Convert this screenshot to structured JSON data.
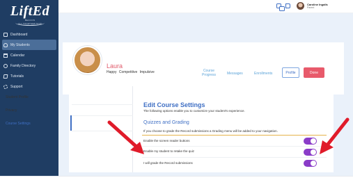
{
  "app": {
    "logo_text": "LiftEd",
    "logo_subtitle": "BEACON",
    "logo_tagline": "ALL TOGETHER NOW"
  },
  "sidebar": {
    "items": [
      {
        "label": "Dashboard",
        "icon": "dashboard-icon",
        "active": false
      },
      {
        "label": "My Students",
        "icon": "students-icon",
        "active": true
      },
      {
        "label": "Calendar",
        "icon": "calendar-icon",
        "active": false
      },
      {
        "label": "Family Directory",
        "icon": "family-icon",
        "active": false
      },
      {
        "label": "Tutorials",
        "icon": "tutorials-icon",
        "active": false
      },
      {
        "label": "Support",
        "icon": "support-icon",
        "active": false
      }
    ]
  },
  "topbar": {
    "user_name": "Caroline Ingalls",
    "user_role": "Parent",
    "icons": [
      "chat-icon",
      "book-icon"
    ]
  },
  "student": {
    "name": "Laura",
    "traits": "Happy  Competitive  Impulsive"
  },
  "tabs": {
    "course_progress": "Course Progress",
    "messages": "Messages",
    "enrollments": "Enrollments",
    "profile_button": "Profile",
    "done_button": "Done"
  },
  "settings": {
    "side_tabs": [
      "Student Profile",
      "Privacy",
      "Course Settings"
    ],
    "active_tab": "Course Settings",
    "title": "Edit Course Settings",
    "description": "The following options enable you to customize your student's experience.",
    "section_title": "Quizzes and Grading",
    "section_description": "If you choose to grade the Record submissions a Grading menu will be added to your navigation.",
    "options": [
      {
        "label": "Enable the screen reader buttons",
        "enabled": true
      },
      {
        "label": "Enable my student to retake the quiz",
        "enabled": true
      },
      {
        "label": "I will grade the Record submissions",
        "enabled": true
      }
    ]
  },
  "colors": {
    "sidebar_bg": "#1f3d63",
    "accent_blue": "#3f6fc4",
    "toggle_purple": "#8a3cc8",
    "done_red": "#e85a6b",
    "annotation_arrow": "#e01b2a"
  }
}
